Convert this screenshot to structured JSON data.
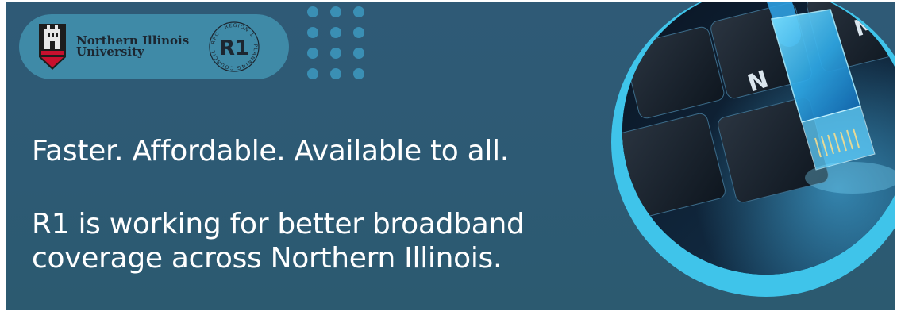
{
  "logos": {
    "niu_line1": "Northern Illinois",
    "niu_line2": "University",
    "r1_mark": "R1",
    "r1_ring_text": "RPC · REGION 1 · PLANNING COUNCIL"
  },
  "headline": "Faster. Affordable. Available to all.",
  "body": {
    "line1": "R1 is working for better broadband",
    "line2": "coverage across Northern Illinois."
  },
  "photo": {
    "key_letter_n": "N",
    "key_letter_m": "M"
  },
  "colors": {
    "background": "#2d5a74",
    "pill": "#3f8aa7",
    "dots": "#3a8fb4",
    "ring_accent": "#3fc4ea",
    "text": "#ffffff",
    "niu_red": "#c8102e"
  }
}
